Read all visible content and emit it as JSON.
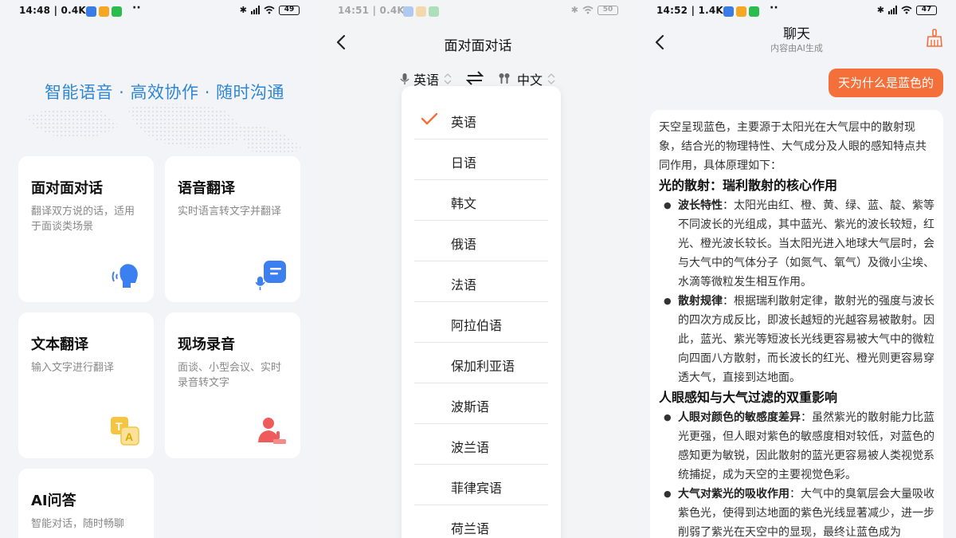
{
  "panel1": {
    "status": {
      "time": "14:48",
      "speed": "0.4K/s",
      "battery": "49"
    },
    "slogan": "智能语音 · 高效协作 · 随时沟通",
    "cards": [
      {
        "title": "面对面对话",
        "desc": "翻译双方说的话，适用于面谈类场景",
        "icon": "head-speaking-icon"
      },
      {
        "title": "语音翻译",
        "desc": "实时语言转文字并翻译",
        "icon": "mic-chat-icon"
      },
      {
        "title": "文本翻译",
        "desc": "输入文字进行翻译",
        "icon": "text-translate-icon"
      },
      {
        "title": "现场录音",
        "desc": "面谈、小型会议、实时录音转文字",
        "icon": "speaker-podium-icon"
      },
      {
        "title": "AI问答",
        "desc": "智能对话，随时畅聊",
        "icon": ""
      }
    ]
  },
  "panel2": {
    "status": {
      "time": "14:51",
      "speed": "0.4K/s",
      "battery": "50"
    },
    "title": "面对面对话",
    "source_lang": "英语",
    "target_lang": "中文",
    "options": [
      "英语",
      "日语",
      "韩文",
      "俄语",
      "法语",
      "阿拉伯语",
      "保加利亚语",
      "波斯语",
      "波兰语",
      "菲律宾语",
      "荷兰语"
    ],
    "selected_index": 0
  },
  "panel3": {
    "status": {
      "time": "14:52",
      "speed": "1.4K/s",
      "battery": "47"
    },
    "title": "聊天",
    "subtitle": "内容由AI生成",
    "question": "天为什么是蓝色的",
    "intro": "天空呈现蓝色，主要源于太阳光在大气层中的散射现象，结合光的物理特性、大气成分及人眼的感知特点共同作用，具体原理如下：",
    "h1": "光的散射：瑞利散射的核心作用",
    "b1_label": "波长特性",
    "b1_text": "：太阳光由红、橙、黄、绿、蓝、靛、紫等不同波长的光组成，其中蓝光、紫光的波长较短，红光、橙光波长较长。当太阳光进入地球大气层时，会与大气中的气体分子（如氮气、氧气）及微小尘埃、水滴等微粒发生相互作用。",
    "b2_label": "散射规律",
    "b2_text": "：根据瑞利散射定律，散射光的强度与波长的四次方成反比，即波长越短的光越容易被散射。因此，蓝光、紫光等短波长光线更容易被大气中的微粒向四面八方散射，而长波长的红光、橙光则更容易穿透大气，直接到达地面。",
    "h2": "人眼感知与大气过滤的双重影响",
    "b3_label": "人眼对颜色的敏感度差异",
    "b3_text": "：虽然紫光的散射能力比蓝光更强，但人眼对紫色的敏感度相对较低，对蓝色的感知更为敏锐，因此散射的蓝光更容易被人类视觉系统捕捉，成为天空的主要视觉色彩。",
    "b4_label": "大气对紫光的吸收作用",
    "b4_text": "：大气中的臭氧层会大量吸收紫色光，使得到达地面的紫色光线显著减少，进一步削弱了紫光在天空中的显现，最终让蓝色成为"
  },
  "colors": {
    "accent": "#f46f3a",
    "blue": "#2f86d4",
    "icon_blue": "#3b7ff0"
  }
}
